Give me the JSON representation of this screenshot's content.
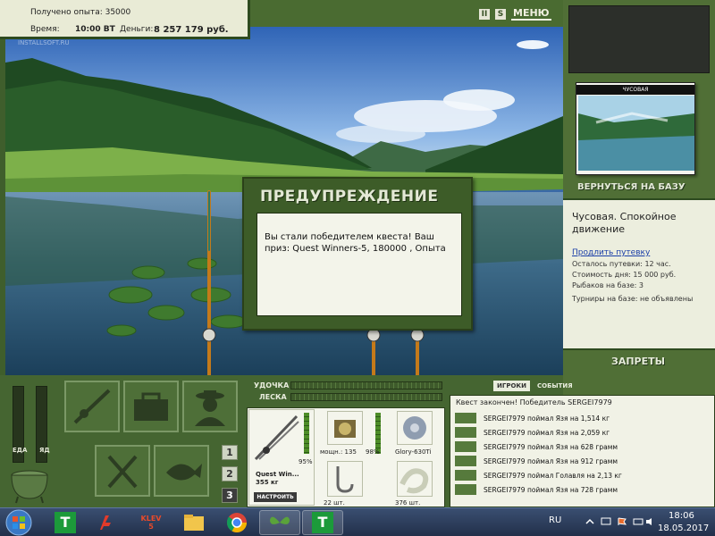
{
  "info": {
    "experience": "Получено опыта: 35000",
    "time_label": "Время:",
    "time_value": "10:00 ВТ",
    "money_label": "Деньги:",
    "money_value": "8 257 179 руб."
  },
  "topbar": {
    "pause_label": "II",
    "s_label": "S",
    "menu_label": "МЕНЮ"
  },
  "scene": {
    "watermark": "INSTALLSOFT.RU"
  },
  "dialog": {
    "title": "ПРЕДУПРЕЖДЕНИЕ",
    "message": "Вы стали победителем квеста! Ваш приз: Quest Winners-5, 180000 , Опыта"
  },
  "sidebar": {
    "location_card_title": "ЧУСОВАЯ",
    "return_label": "ВЕРНУТЬСЯ НА БАЗУ",
    "location_name": "Чусовая. Спокойное движение",
    "extend_link": "Продлить путевку",
    "remaining": "Осталось путевки: 12 час.",
    "day_cost": "Стоимость дня: 15 000 руб.",
    "anglers": "Рыбаков на базе: 3",
    "tournaments": "Турниры на базе: не объявлены",
    "bans_label": "ЗАПРЕТЫ"
  },
  "bottom": {
    "meter1_label": "ЕДА",
    "meter2_label": "ЯД",
    "pages": [
      "1",
      "2",
      "3"
    ],
    "active_page": "3",
    "rod_label": "УДОЧКА",
    "line_label": "ЛЕСКА"
  },
  "gear": {
    "rod_name": "Quest Win...",
    "rod_weight": "355 кг",
    "rod_pct": "95%",
    "reel_power": "мощн.: 135",
    "reel_pct": "98%",
    "line_name": "Glory-630Ti",
    "hooks_count": "22 шт.",
    "bait_count": "376 шт.",
    "tune_label": "НАСТРОИТЬ"
  },
  "events": {
    "tab_players": "ИГРОКИ",
    "tab_events": "СОБЫТИЯ",
    "headline": "Квест закончен! Победитель SERGEI7979",
    "items": [
      "SERGEI7979 поймал Язя на 1,514 кг",
      "SERGEI7979 поймал Язя на 2,059 кг",
      "SERGEI7979 поймал Язя на 628 грамм",
      "SERGEI7979 поймал Язя на 912 грамм",
      "SERGEI7979 поймал Голавля на 2,13 кг",
      "SERGEI7979 поймал Язя на 728 грамм"
    ]
  },
  "taskbar": {
    "language": "RU",
    "time": "18:06",
    "date": "18.05.2017",
    "app_t_label": "T",
    "app_klev_label": "KLEV 5",
    "app_t2_label": "T"
  }
}
